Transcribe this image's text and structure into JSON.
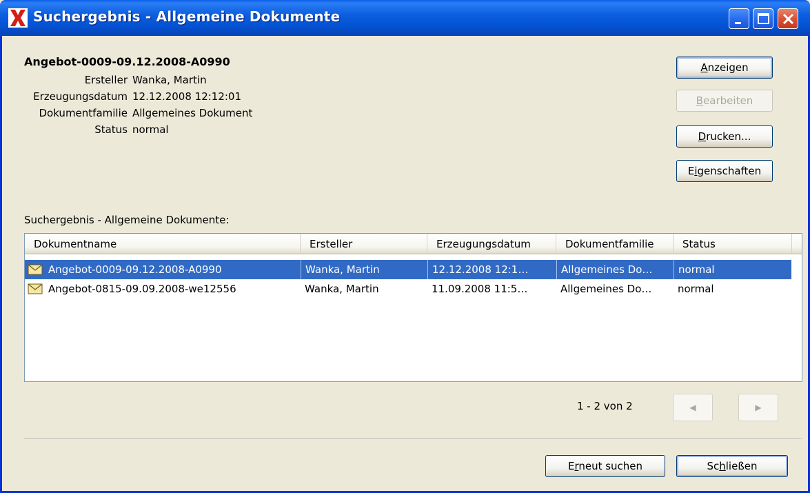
{
  "window": {
    "title": "Suchergebnis - Allgemeine Dokumente"
  },
  "document": {
    "name": "Angebot-0009-09.12.2008-A0990",
    "properties": [
      {
        "label": "Ersteller",
        "value": "Wanka, Martin"
      },
      {
        "label": "Erzeugungsdatum",
        "value": "12.12.2008 12:12:01"
      },
      {
        "label": "Dokumentfamilie",
        "value": "Allgemeines Dokument"
      },
      {
        "label": "Status",
        "value": "normal"
      }
    ]
  },
  "actions": {
    "anzeigen": {
      "accel": "A",
      "rest": "nzeigen"
    },
    "bearbeiten": {
      "accel": "B",
      "rest": "earbeiten"
    },
    "drucken": {
      "accel": "D",
      "rest": "rucken..."
    },
    "eigenschaften": {
      "pre": "E",
      "accel": "i",
      "rest": "genschaften"
    }
  },
  "results": {
    "label": "Suchergebnis - Allgemeine Dokumente:",
    "columns": [
      "Dokumentname",
      "Ersteller",
      "Erzeugungsdatum",
      "Dokumentfamilie",
      "Status"
    ],
    "rows": [
      {
        "name": "Angebot-0009-09.12.2008-A0990",
        "creator": "Wanka, Martin",
        "date": "12.12.2008 12:1…",
        "family": "Allgemeines Do…",
        "status": "normal",
        "selected": true
      },
      {
        "name": "Angebot-0815-09.09.2008-we12556",
        "creator": "Wanka, Martin",
        "date": "11.09.2008 11:5…",
        "family": "Allgemeines Do…",
        "status": "normal",
        "selected": false
      }
    ]
  },
  "pager": {
    "text": "1 - 2 von 2",
    "prev_icon": "◀",
    "next_icon": "▶"
  },
  "footer": {
    "search_again": {
      "pre": "E",
      "accel": "r",
      "rest": "neut suchen"
    },
    "close": {
      "pre": "Sc",
      "accel": "h",
      "rest": "ließen"
    }
  },
  "icons": {
    "app": "app-x-icon",
    "document": "envelope-icon"
  },
  "colors": {
    "titlebar": "#0453d6",
    "selection": "#316ac5",
    "dialog_bg": "#ece9d8"
  }
}
